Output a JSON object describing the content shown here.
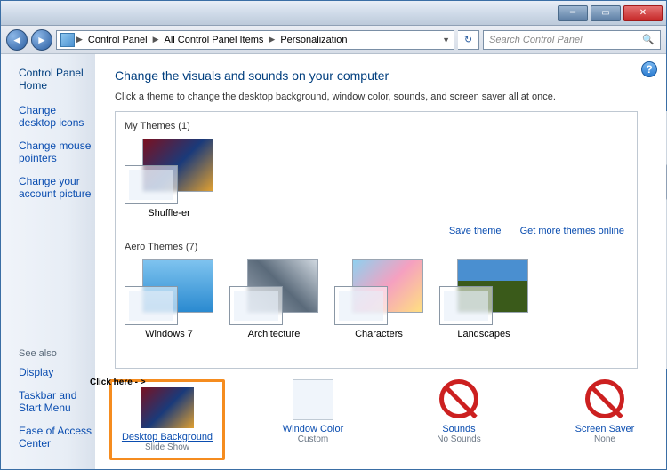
{
  "breadcrumbs": [
    "Control Panel",
    "All Control Panel Items",
    "Personalization"
  ],
  "search": {
    "placeholder": "Search Control Panel"
  },
  "sidebar": {
    "home": "Control Panel Home",
    "links": [
      "Change desktop icons",
      "Change mouse pointers",
      "Change your account picture"
    ],
    "seealso_header": "See also",
    "seealso": [
      "Display",
      "Taskbar and Start Menu",
      "Ease of Access Center"
    ]
  },
  "main": {
    "title": "Change the visuals and sounds on your computer",
    "subtitle": "Click a theme to change the desktop background, window color, sounds, and screen saver all at once.",
    "mythemes_label": "My Themes (1)",
    "mythemes": [
      {
        "name": "Shuffle-er"
      }
    ],
    "save_theme": "Save theme",
    "more_online": "Get more themes online",
    "aero_label": "Aero Themes (7)",
    "aero": [
      {
        "name": "Windows 7"
      },
      {
        "name": "Architecture"
      },
      {
        "name": "Characters"
      },
      {
        "name": "Landscapes"
      }
    ]
  },
  "bottom": {
    "bg": {
      "label": "Desktop Background",
      "value": "Slide Show"
    },
    "color": {
      "label": "Window Color",
      "value": "Custom"
    },
    "sounds": {
      "label": "Sounds",
      "value": "No Sounds"
    },
    "saver": {
      "label": "Screen Saver",
      "value": "None"
    }
  },
  "annotation": "Click here - >"
}
